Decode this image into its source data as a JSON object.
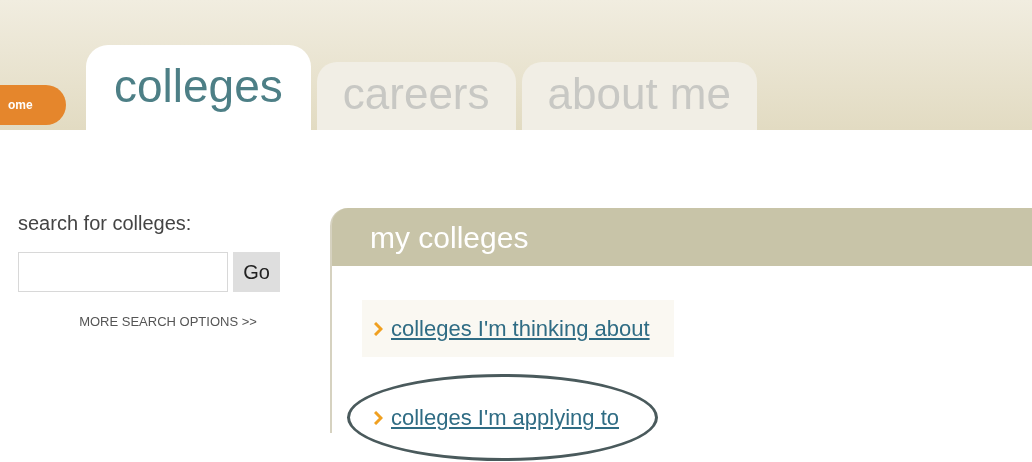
{
  "home_button": {
    "label": "ome"
  },
  "tabs": [
    {
      "label": "colleges",
      "selected": true
    },
    {
      "label": "careers",
      "selected": false
    },
    {
      "label": "about me",
      "selected": false
    }
  ],
  "search": {
    "label": "search for colleges:",
    "button": "Go",
    "more_link": "MORE SEARCH OPTIONS >>"
  },
  "panel": {
    "title": "my colleges",
    "links": [
      {
        "label": "colleges I'm thinking about",
        "highlighted": false
      },
      {
        "label": "colleges I'm applying to",
        "highlighted": true
      }
    ]
  }
}
